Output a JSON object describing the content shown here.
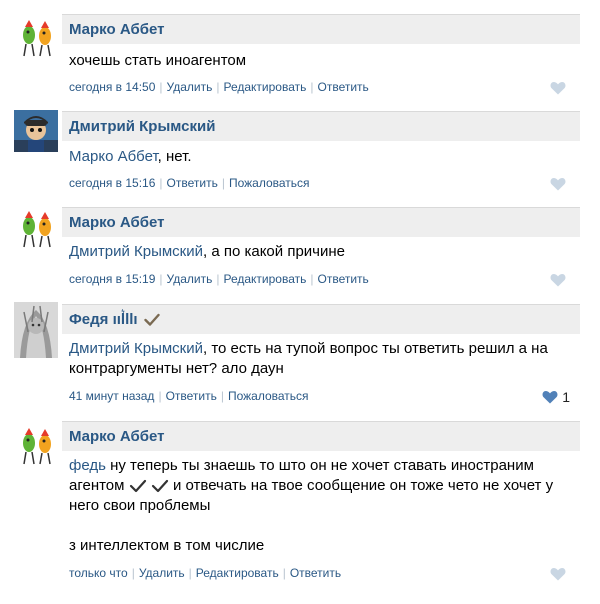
{
  "comments": [
    {
      "author": "Марко Аббет",
      "text": "хочешь стать иноагентом",
      "time": "сегодня в 14:50",
      "actions": [
        "Удалить",
        "Редактировать",
        "Ответить"
      ],
      "liked": false
    },
    {
      "author": "Дмитрий Крымский",
      "mention": "Марко Аббет",
      "text": ", нет.",
      "time": "сегодня в 15:16",
      "actions": [
        "Ответить",
        "Пожаловаться"
      ],
      "liked": false
    },
    {
      "author": "Марко Аббет",
      "mention": "Дмитрий Крымский",
      "text": ", а по какой причине",
      "time": "сегодня в 15:19",
      "actions": [
        "Удалить",
        "Редактировать",
        "Ответить"
      ],
      "liked": false
    },
    {
      "author": "Федя ııl͛llı",
      "mention": "Дмитрий Крымский",
      "text": ", то есть на тупой вопрос ты ответить решил а на контраргументы нет? ало даун",
      "time": "41 минут назад",
      "actions": [
        "Ответить",
        "Пожаловаться"
      ],
      "liked": true,
      "likes": "1"
    },
    {
      "author": "Марко Аббет",
      "mention": "федь",
      "text": " ну теперь ты знаешь то што он не хочет ставать иностраним агентом",
      "text_after": " и отвечать на твое сообщение он тоже чето не хочет у него свои проблемы",
      "text_para2": "з интеллектом в том числие",
      "time": "только что",
      "actions": [
        "Удалить",
        "Редактировать",
        "Ответить"
      ],
      "liked": false
    }
  ],
  "colors": {
    "link": "#2a5885",
    "header_bg": "#eeeeee",
    "like_inactive": "#c9d6e3",
    "like_active": "#5181b8"
  }
}
